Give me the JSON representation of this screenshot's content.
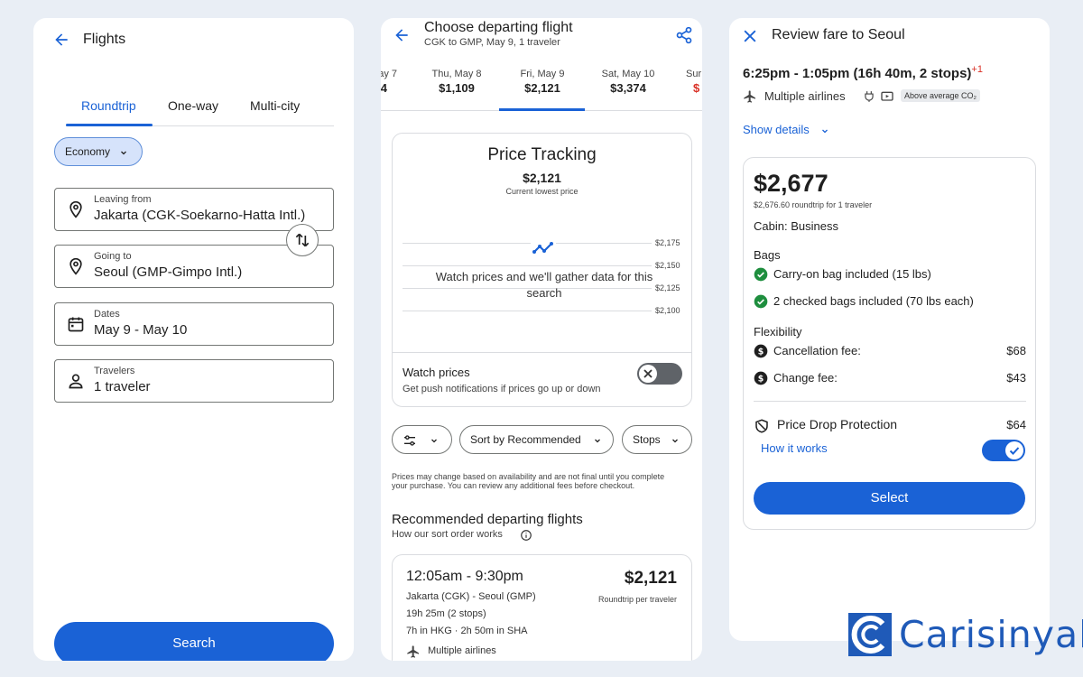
{
  "flights_panel": {
    "title": "Flights",
    "tabs": [
      "Roundtrip",
      "One-way",
      "Multi-city"
    ],
    "active_tab": "Roundtrip",
    "cabin": "Economy",
    "leaving": {
      "label": "Leaving from",
      "value": "Jakarta (CGK-Soekarno-Hatta Intl.)"
    },
    "going": {
      "label": "Going to",
      "value": "Seoul (GMP-Gimpo Intl.)"
    },
    "dates": {
      "label": "Dates",
      "value": "May 9 - May 10"
    },
    "travelers": {
      "label": "Travelers",
      "value": "1 traveler"
    },
    "search_label": "Search"
  },
  "departing_panel": {
    "title": "Choose departing flight",
    "subtitle": "CGK to GMP, May 9, 1 traveler",
    "dates": [
      {
        "label": "ay 7",
        "price": "4"
      },
      {
        "label": "Thu, May 8",
        "price": "$1,109"
      },
      {
        "label": "Fri, May 9",
        "price": "$2,121"
      },
      {
        "label": "Sat, May 10",
        "price": "$3,374"
      },
      {
        "label": "Sur",
        "price": "$"
      }
    ],
    "selected_date_index": 2,
    "price_tracking": {
      "title": "Price Tracking",
      "price": "$2,121",
      "caption": "Current lowest price",
      "y_ticks": [
        "$2,175",
        "$2,150",
        "$2,125",
        "$2,100"
      ],
      "watch_text": "Watch prices and we'll gather data for this search",
      "watch_label": "Watch prices",
      "watch_sub": "Get push notifications if prices go up or down",
      "watch_enabled": false
    },
    "filters": {
      "sort": "Sort by Recommended",
      "stops": "Stops"
    },
    "disclaimer": "Prices may change based on availability and are not final until you complete your purchase. You can review any additional fees before checkout.",
    "rec_title": "Recommended departing flights",
    "rec_sub": "How our sort order works",
    "flight": {
      "time": "12:05am - 9:30pm",
      "price": "$2,121",
      "price_note": "Roundtrip per traveler",
      "route": "Jakarta (CGK) - Seoul (GMP)",
      "duration": "19h 25m (2 stops)",
      "layovers": "7h in HKG · 2h 50m in SHA",
      "airline": "Multiple airlines"
    }
  },
  "fare_panel": {
    "title": "Review fare to Seoul",
    "time": "6:25pm - 1:05pm (16h 40m, 2 stops)",
    "day_offset": "+1",
    "airline": "Multiple airlines",
    "co2": "Above average CO₂",
    "show_details": "Show details",
    "price": "$2,677",
    "price_note": "$2,676.60 roundtrip for 1 traveler",
    "cabin": "Cabin: Business",
    "bags_title": "Bags",
    "bags": [
      "Carry-on bag included (15 lbs)",
      "2 checked bags included (70 lbs each)"
    ],
    "flex_title": "Flexibility",
    "cancel_label": "Cancellation fee:",
    "cancel_value": "$68",
    "change_label": "Change fee:",
    "change_value": "$43",
    "pdp_label": "Price Drop Protection",
    "pdp_value": "$64",
    "how_label": "How it works",
    "pdp_enabled": true,
    "select_label": "Select"
  },
  "watermark": {
    "text": "Carisinyal"
  },
  "colors": {
    "accent": "#1a62d6",
    "success": "#1e8e3e",
    "warning": "#d93025"
  }
}
